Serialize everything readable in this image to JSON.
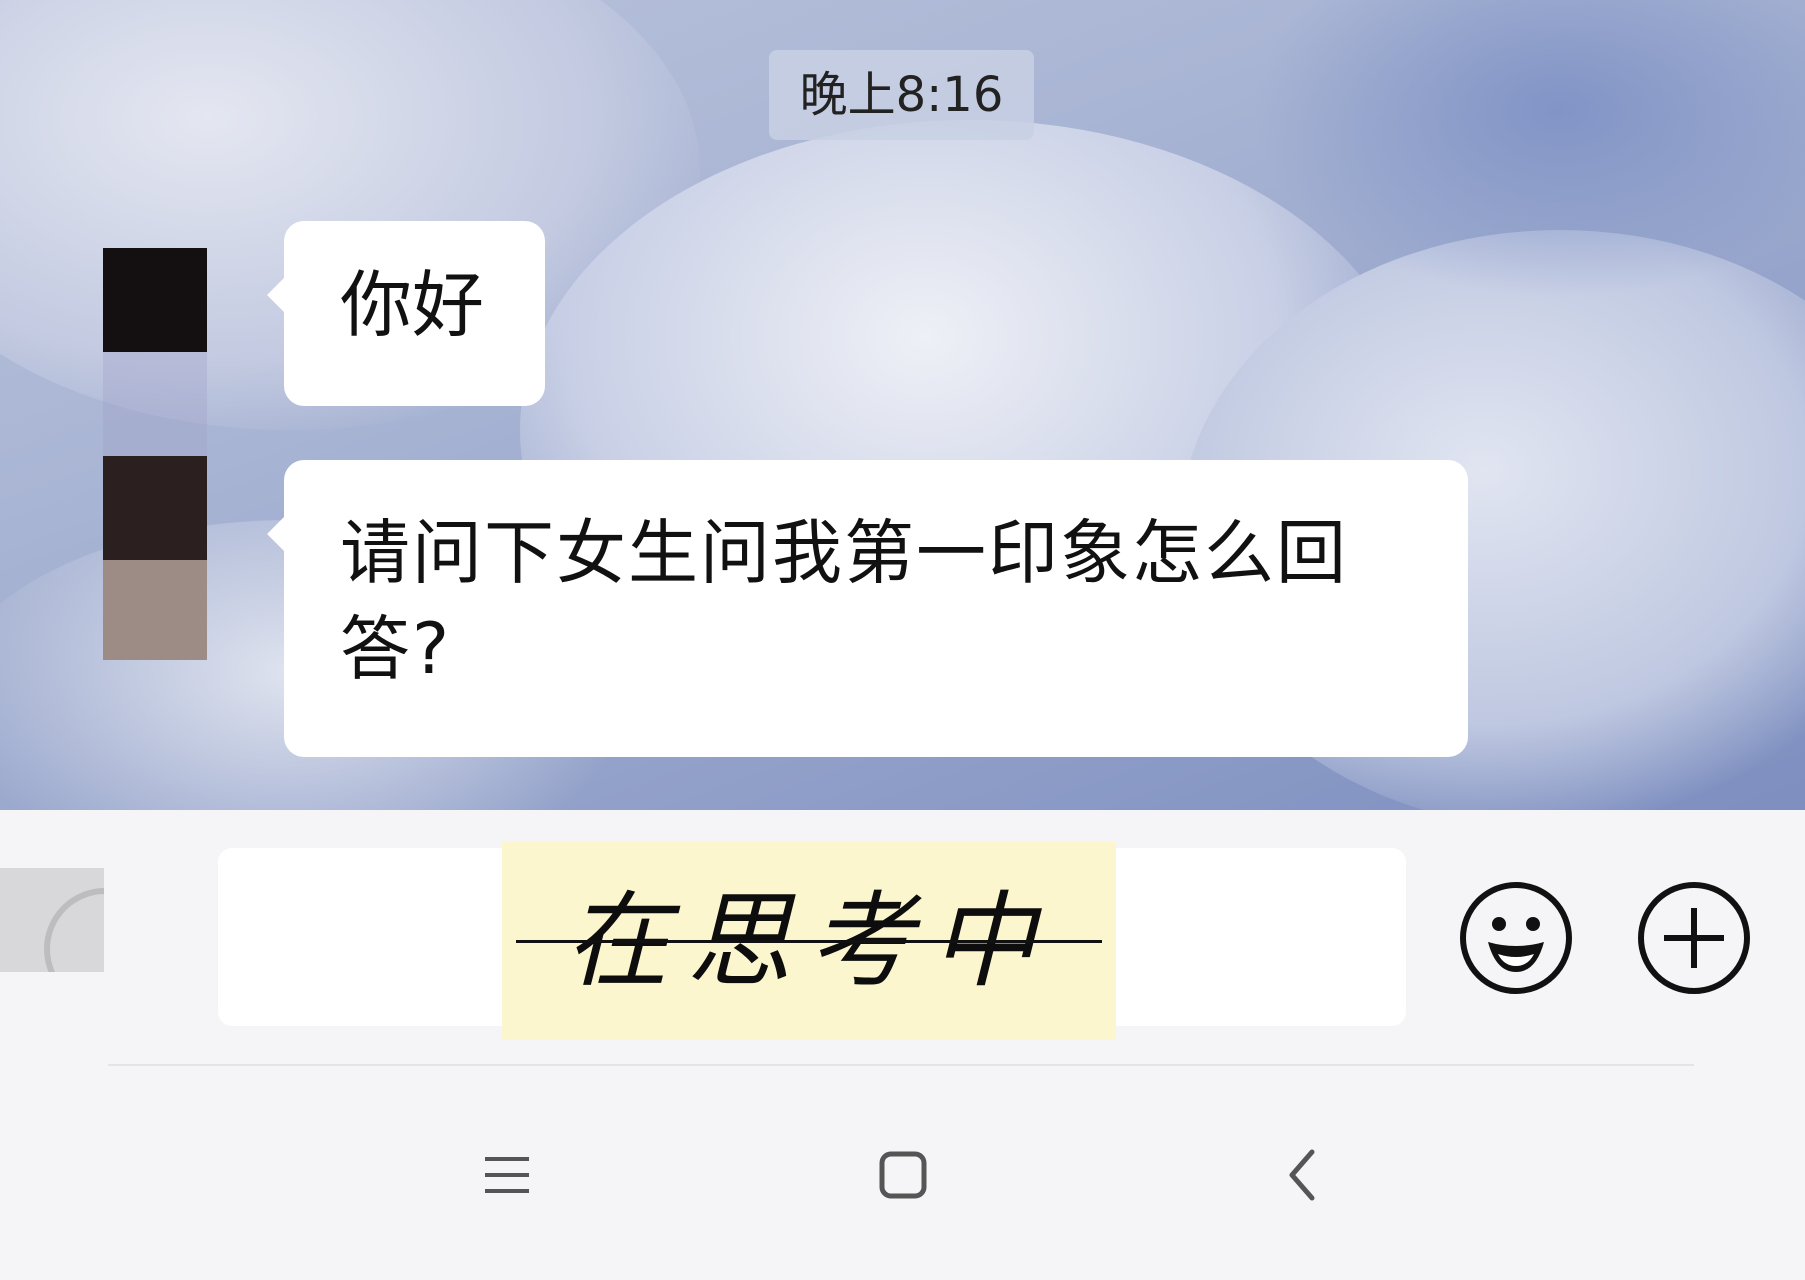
{
  "chat": {
    "timestamp": "晚上8:16",
    "messages": [
      {
        "sender": "other",
        "text": "你好"
      },
      {
        "sender": "other",
        "text_line1": "请问下女生问我第一印象怎么回",
        "text_line2": "答?"
      }
    ]
  },
  "input_bar": {
    "sticker_text": "在思考中",
    "icons": [
      "voice-icon",
      "emoji-icon",
      "plus-icon"
    ]
  },
  "nav_bar": {
    "icons": [
      "menu-icon",
      "home-icon",
      "back-icon"
    ]
  },
  "colors": {
    "bubble": "#ffffff",
    "sticker_bg": "#fcf6cf",
    "toolbar_bg": "#f5f5f7"
  }
}
